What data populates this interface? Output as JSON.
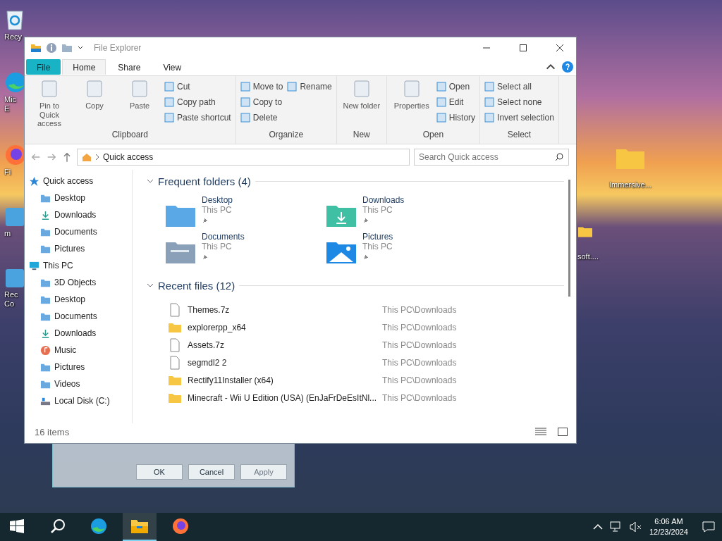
{
  "desktop": {
    "icons_left": [
      {
        "label": "Recy",
        "kind": "recycle"
      },
      {
        "label": "Mic\nE",
        "kind": "edge"
      },
      {
        "label": "Fi",
        "kind": "firefox"
      },
      {
        "label": "m",
        "kind": "app"
      },
      {
        "label": "Rec\nCo",
        "kind": "app"
      }
    ],
    "icons_right": [
      {
        "label": "Immersive...",
        "kind": "folder"
      },
      {
        "label": "soft....",
        "kind": "folder"
      }
    ]
  },
  "explorer": {
    "title": "File Explorer",
    "tabs": [
      {
        "label": "File",
        "kind": "file",
        "selected": false
      },
      {
        "label": "Home",
        "kind": "tab",
        "selected": true
      },
      {
        "label": "Share",
        "kind": "tab",
        "selected": false
      },
      {
        "label": "View",
        "kind": "tab",
        "selected": false
      }
    ],
    "ribbon": [
      {
        "name": "Clipboard",
        "items": [
          {
            "label": "Pin to Quick access",
            "kind": "large"
          },
          {
            "label": "Copy",
            "kind": "large"
          },
          {
            "label": "Paste",
            "kind": "large"
          },
          {
            "label": "Cut",
            "kind": "small"
          },
          {
            "label": "Copy path",
            "kind": "small"
          },
          {
            "label": "Paste shortcut",
            "kind": "small"
          }
        ]
      },
      {
        "name": "Organize",
        "items": [
          {
            "label": "Move to",
            "kind": "small"
          },
          {
            "label": "Copy to",
            "kind": "small"
          },
          {
            "label": "Delete",
            "kind": "small"
          },
          {
            "label": "Rename",
            "kind": "small"
          }
        ]
      },
      {
        "name": "New",
        "items": [
          {
            "label": "New folder",
            "kind": "large"
          }
        ]
      },
      {
        "name": "Open",
        "items": [
          {
            "label": "Properties",
            "kind": "large"
          },
          {
            "label": "Open",
            "kind": "small"
          },
          {
            "label": "Edit",
            "kind": "small"
          },
          {
            "label": "History",
            "kind": "small"
          }
        ]
      },
      {
        "name": "Select",
        "items": [
          {
            "label": "Select all",
            "kind": "small"
          },
          {
            "label": "Select none",
            "kind": "small"
          },
          {
            "label": "Invert selection",
            "kind": "small"
          }
        ]
      }
    ],
    "address": "Quick access",
    "search": {
      "placeholder": "Search Quick access"
    },
    "nav": [
      {
        "label": "Quick access",
        "kind": "star",
        "children": [
          {
            "label": "Desktop",
            "kind": "folder"
          },
          {
            "label": "Downloads",
            "kind": "download"
          },
          {
            "label": "Documents",
            "kind": "folder"
          },
          {
            "label": "Pictures",
            "kind": "folder"
          }
        ]
      },
      {
        "label": "This PC",
        "kind": "pc",
        "children": [
          {
            "label": "3D Objects",
            "kind": "folder"
          },
          {
            "label": "Desktop",
            "kind": "folder"
          },
          {
            "label": "Documents",
            "kind": "folder"
          },
          {
            "label": "Downloads",
            "kind": "download"
          },
          {
            "label": "Music",
            "kind": "music"
          },
          {
            "label": "Pictures",
            "kind": "folder"
          },
          {
            "label": "Videos",
            "kind": "folder"
          },
          {
            "label": "Local Disk (C:)",
            "kind": "disk"
          }
        ]
      }
    ],
    "frequent": {
      "heading": "Frequent folders (4)",
      "items": [
        {
          "name": "Desktop",
          "location": "This PC",
          "kind": "desktop"
        },
        {
          "name": "Downloads",
          "location": "This PC",
          "kind": "downloads"
        },
        {
          "name": "Documents",
          "location": "This PC",
          "kind": "documents"
        },
        {
          "name": "Pictures",
          "location": "This PC",
          "kind": "pictures"
        }
      ]
    },
    "recent": {
      "heading": "Recent files (12)",
      "items": [
        {
          "name": "Themes.7z",
          "location": "This PC\\Downloads",
          "kind": "file"
        },
        {
          "name": "explorerpp_x64",
          "location": "This PC\\Downloads",
          "kind": "folder"
        },
        {
          "name": "Assets.7z",
          "location": "This PC\\Downloads",
          "kind": "file"
        },
        {
          "name": "segmdl2 2",
          "location": "This PC\\Downloads",
          "kind": "file"
        },
        {
          "name": "Rectify11Installer (x64)",
          "location": "This PC\\Downloads",
          "kind": "folder"
        },
        {
          "name": "Minecraft - Wii U Edition (USA) (EnJaFrDeEsItNl...",
          "location": "This PC\\Downloads",
          "kind": "folder"
        }
      ]
    },
    "status": "16 items"
  },
  "folder_options": {
    "buttons": [
      {
        "label": "OK",
        "disabled": false
      },
      {
        "label": "Cancel",
        "disabled": false
      },
      {
        "label": "Apply",
        "disabled": true
      }
    ]
  },
  "taskbar": {
    "apps": [
      {
        "kind": "start",
        "selected": false
      },
      {
        "kind": "search",
        "selected": false
      },
      {
        "kind": "edge",
        "selected": false
      },
      {
        "kind": "explorer",
        "selected": true
      },
      {
        "kind": "firefox",
        "selected": false
      }
    ],
    "time": "6:06 AM",
    "date": "12/23/2024"
  }
}
